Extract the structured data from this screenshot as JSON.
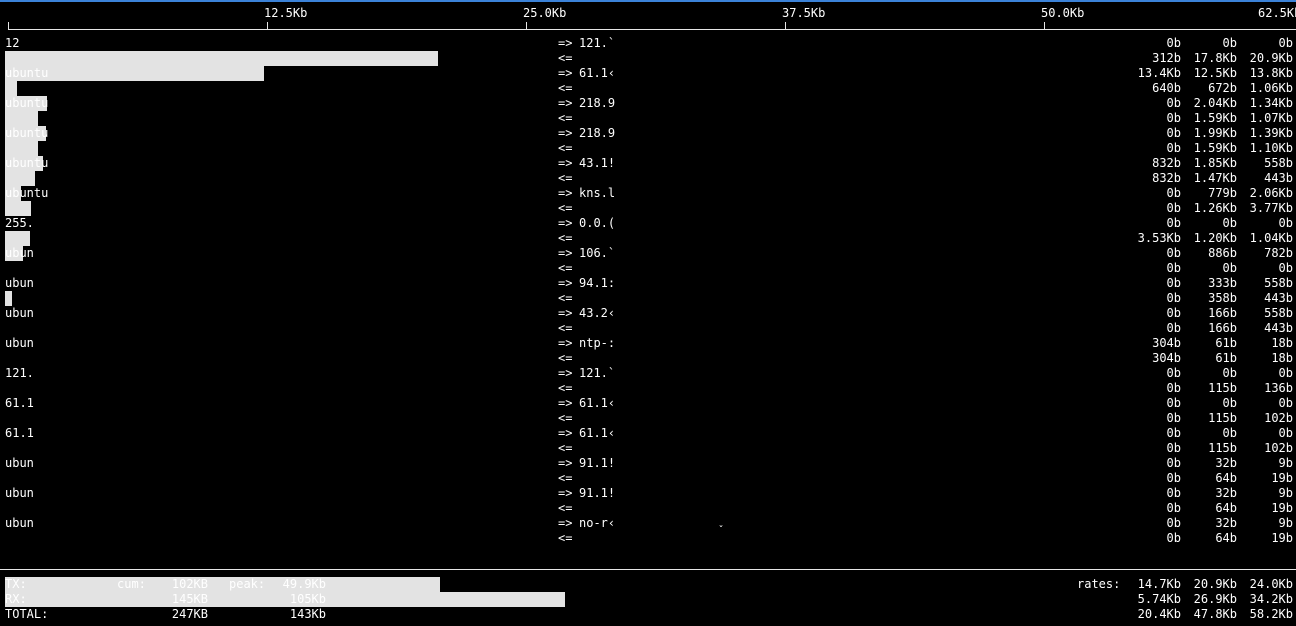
{
  "scale": {
    "ticks": [
      "12.5Kb",
      "25.0Kb",
      "37.5Kb",
      "50.0Kb",
      "62.5Kb"
    ],
    "max_kb": 62.5
  },
  "rows": [
    {
      "src": "12",
      "dst": "121.`",
      "tx": [
        "0b",
        "0b",
        "0b"
      ],
      "rx": [
        "312b",
        "17.8Kb",
        "20.9Kb"
      ],
      "bar_tx_kb": 0,
      "bar_rx_kb": 20.9
    },
    {
      "src": "ubuntu",
      "dst": "61.1‹",
      "tx": [
        "13.4Kb",
        "12.5Kb",
        "13.8Kb"
      ],
      "rx": [
        "640b",
        "672b",
        "1.06Kb"
      ],
      "bar_tx_kb": 12.5,
      "bar_rx_kb": 0.6
    },
    {
      "src": "ubuntu",
      "dst": "218.9",
      "tx": [
        "0b",
        "2.04Kb",
        "1.34Kb"
      ],
      "rx": [
        "0b",
        "1.59Kb",
        "1.07Kb"
      ],
      "bar_tx_kb": 2.04,
      "bar_rx_kb": 1.59
    },
    {
      "src": "ubuntu",
      "dst": "218.9",
      "tx": [
        "0b",
        "1.99Kb",
        "1.39Kb"
      ],
      "rx": [
        "0b",
        "1.59Kb",
        "1.10Kb"
      ],
      "bar_tx_kb": 1.99,
      "bar_rx_kb": 1.59
    },
    {
      "src": "ubuntu",
      "dst": "43.1!",
      "tx": [
        "832b",
        "1.85Kb",
        "558b"
      ],
      "rx": [
        "832b",
        "1.47Kb",
        "443b"
      ],
      "bar_tx_kb": 1.85,
      "bar_rx_kb": 1.47
    },
    {
      "src": "ubuntu",
      "dst": "kns.l",
      "tx": [
        "0b",
        "779b",
        "2.06Kb"
      ],
      "rx": [
        "0b",
        "1.26Kb",
        "3.77Kb"
      ],
      "bar_tx_kb": 0.78,
      "bar_rx_kb": 1.26
    },
    {
      "src": "255.",
      "dst": "0.0.(",
      "tx": [
        "0b",
        "0b",
        "0b"
      ],
      "rx": [
        "3.53Kb",
        "1.20Kb",
        "1.04Kb"
      ],
      "bar_tx_kb": 0,
      "bar_rx_kb": 1.2
    },
    {
      "src": "ubun",
      "dst": "106.`",
      "tx": [
        "0b",
        "886b",
        "782b"
      ],
      "rx": [
        "0b",
        "0b",
        "0b"
      ],
      "bar_tx_kb": 0.89,
      "bar_rx_kb": 0
    },
    {
      "src": "ubun",
      "dst": "94.1:",
      "tx": [
        "0b",
        "333b",
        "558b"
      ],
      "rx": [
        "0b",
        "358b",
        "443b"
      ],
      "bar_tx_kb": 0,
      "bar_rx_kb": 0.36
    },
    {
      "src": "ubun",
      "dst": "43.2‹",
      "tx": [
        "0b",
        "166b",
        "558b"
      ],
      "rx": [
        "0b",
        "166b",
        "443b"
      ],
      "bar_tx_kb": 0,
      "bar_rx_kb": 0
    },
    {
      "src": "ubun",
      "dst": "ntp-:",
      "tx": [
        "304b",
        "61b",
        "18b"
      ],
      "rx": [
        "304b",
        "61b",
        "18b"
      ],
      "bar_tx_kb": 0,
      "bar_rx_kb": 0
    },
    {
      "src": "121.",
      "dst": "121.`",
      "tx": [
        "0b",
        "0b",
        "0b"
      ],
      "rx": [
        "0b",
        "115b",
        "136b"
      ],
      "bar_tx_kb": 0,
      "bar_rx_kb": 0
    },
    {
      "src": "61.1",
      "dst": "61.1‹",
      "tx": [
        "0b",
        "0b",
        "0b"
      ],
      "rx": [
        "0b",
        "115b",
        "102b"
      ],
      "bar_tx_kb": 0,
      "bar_rx_kb": 0
    },
    {
      "src": "61.1",
      "dst": "61.1‹",
      "tx": [
        "0b",
        "0b",
        "0b"
      ],
      "rx": [
        "0b",
        "115b",
        "102b"
      ],
      "bar_tx_kb": 0,
      "bar_rx_kb": 0
    },
    {
      "src": "ubun",
      "dst": "91.1!",
      "tx": [
        "0b",
        "32b",
        "9b"
      ],
      "rx": [
        "0b",
        "64b",
        "19b"
      ],
      "bar_tx_kb": 0,
      "bar_rx_kb": 0
    },
    {
      "src": "ubun",
      "dst": "91.1!",
      "tx": [
        "0b",
        "32b",
        "9b"
      ],
      "rx": [
        "0b",
        "64b",
        "19b"
      ],
      "bar_tx_kb": 0,
      "bar_rx_kb": 0
    },
    {
      "src": "ubun",
      "dst": "no-r‹",
      "tx": [
        "0b",
        "32b",
        "9b"
      ],
      "rx": [
        "0b",
        "64b",
        "19b"
      ],
      "bar_tx_kb": 0,
      "bar_rx_kb": 0
    }
  ],
  "arrows": {
    "out": "=>",
    "in": "<="
  },
  "stray_mark": "ˇ",
  "footer": {
    "tx_label": "TX:",
    "rx_label": "RX:",
    "total_label": "TOTAL:",
    "cum_label": "cum:",
    "peak_label": "peak:",
    "rates_label": "rates:",
    "tx_cum": "102KB",
    "tx_peak": "49.9Kb",
    "tx_rates": [
      "14.7Kb",
      "20.9Kb",
      "24.0Kb"
    ],
    "tx_bar_kb": 24.0,
    "rx_cum": "145KB",
    "rx_peak": "105Kb",
    "rx_rates": [
      "5.74Kb",
      "26.9Kb",
      "34.2Kb"
    ],
    "rx_bar_kb": 34.2,
    "total_cum": "247KB",
    "total_peak": "143Kb",
    "total_rates": [
      "20.4Kb",
      "47.8Kb",
      "58.2Kb"
    ]
  }
}
